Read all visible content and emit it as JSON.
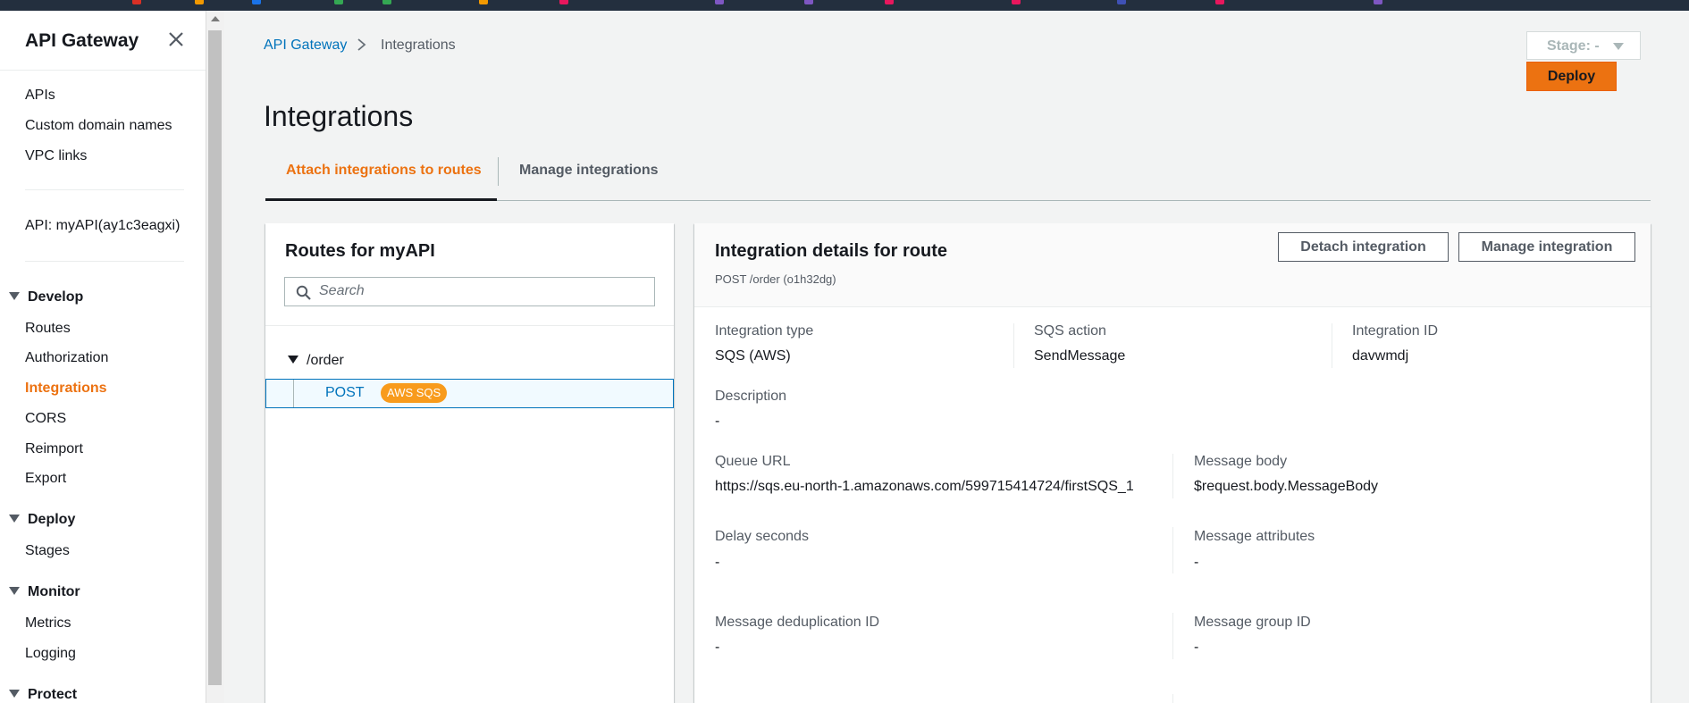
{
  "sidebar": {
    "title": "API Gateway",
    "links_top": [
      "APIs",
      "Custom domain names",
      "VPC links"
    ],
    "api_label": "API: myAPI(ay1c3eagxi)",
    "sections": {
      "develop": {
        "label": "Develop",
        "items": [
          "Routes",
          "Authorization",
          "Integrations",
          "CORS",
          "Reimport",
          "Export"
        ]
      },
      "deploy": {
        "label": "Deploy",
        "items": [
          "Stages"
        ]
      },
      "monitor": {
        "label": "Monitor",
        "items": [
          "Metrics",
          "Logging"
        ]
      },
      "protect": {
        "label": "Protect"
      }
    },
    "active_item": "Integrations"
  },
  "breadcrumb": {
    "root": "API Gateway",
    "current": "Integrations"
  },
  "header": {
    "stage_label": "Stage: -",
    "deploy_label": "Deploy",
    "title": "Integrations"
  },
  "tabs": [
    {
      "label": "Attach integrations to routes",
      "active": true
    },
    {
      "label": "Manage integrations",
      "active": false
    }
  ],
  "routes": {
    "title": "Routes for myAPI",
    "search_placeholder": "Search",
    "path": "/order",
    "method": "POST",
    "badge": "AWS SQS"
  },
  "details": {
    "title": "Integration details for route",
    "subtitle": "POST /order (o1h32dg)",
    "detach_label": "Detach integration",
    "manage_label": "Manage integration",
    "integration_type": {
      "label": "Integration type",
      "value": "SQS (AWS)"
    },
    "sqs_action": {
      "label": "SQS action",
      "value": "SendMessage"
    },
    "integration_id": {
      "label": "Integration ID",
      "value": "davwmdj"
    },
    "description": {
      "label": "Description",
      "value": "-"
    },
    "queue_url": {
      "label": "Queue URL",
      "value": "https://sqs.eu-north-1.amazonaws.com/599715414724/firstSQS_1"
    },
    "message_body": {
      "label": "Message body",
      "value": "$request.body.MessageBody"
    },
    "delay_seconds": {
      "label": "Delay seconds",
      "value": "-"
    },
    "message_attributes": {
      "label": "Message attributes",
      "value": "-"
    },
    "dedup_id": {
      "label": "Message deduplication ID",
      "value": "-"
    },
    "group_id": {
      "label": "Message group ID",
      "value": "-"
    }
  },
  "colors": {
    "accent": "#ec7211",
    "link": "#0073bb",
    "nav": "#232f3e",
    "badge": "#f89b1c"
  },
  "icons": [
    "close-icon",
    "search-icon",
    "chevron-right-icon",
    "caret-down-icon"
  ]
}
